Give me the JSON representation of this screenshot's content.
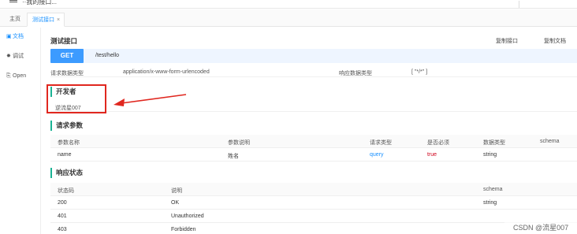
{
  "app": {
    "title": "··我的接口..."
  },
  "tabs": [
    {
      "label": "主页"
    },
    {
      "label": "测试接口",
      "close": "×"
    }
  ],
  "sidebar": {
    "items": [
      {
        "icon": "doc-icon",
        "glyph": "▣",
        "label": "文档"
      },
      {
        "icon": "debug-icon",
        "glyph": "✸",
        "label": "调试"
      },
      {
        "icon": "open-icon",
        "glyph": "⎘",
        "label": "Open"
      }
    ]
  },
  "page": {
    "title": "测试接口",
    "actions": {
      "copy_api": "复制接口",
      "copy_doc": "复制文档"
    },
    "method": "GET",
    "path": "/test/hello"
  },
  "content_type": {
    "request_label": "请求数据类型",
    "request_value": "application/x-www-form-urlencoded",
    "response_label": "响应数据类型",
    "response_value": "[ \"*/*\" ]"
  },
  "developer": {
    "heading": "开发者",
    "value": "逆流星007"
  },
  "request_params": {
    "heading": "请求参数",
    "columns": [
      "参数名称",
      "参数说明",
      "请求类型",
      "是否必须",
      "数据类型",
      "schema"
    ],
    "rows": [
      {
        "name": "name",
        "desc": "姓名",
        "in": "query",
        "required": "true",
        "type": "string",
        "schema": ""
      }
    ]
  },
  "response_status": {
    "heading": "响应状态",
    "columns": [
      "状态码",
      "说明",
      "schema"
    ],
    "rows": [
      {
        "code": "200",
        "desc": "OK",
        "schema": "string"
      },
      {
        "code": "401",
        "desc": "Unauthorized",
        "schema": ""
      },
      {
        "code": "403",
        "desc": "Forbidden",
        "schema": ""
      }
    ]
  },
  "colors": {
    "accent": "#1890ff",
    "method_bg": "#3c9bff",
    "section_bar": "#1ab394",
    "annotation": "#e0271f"
  },
  "watermark": "CSDN @流星007"
}
